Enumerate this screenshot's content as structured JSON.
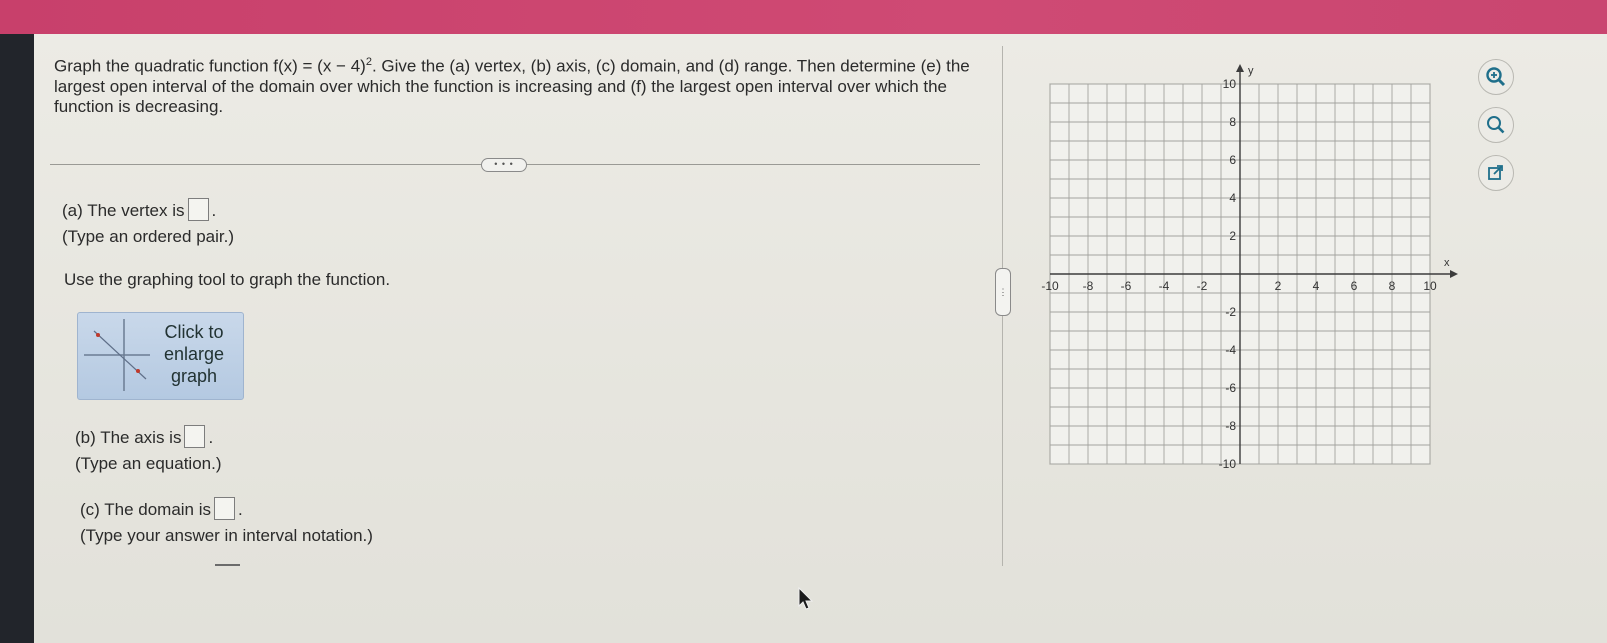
{
  "question": {
    "intro": "Graph the quadratic function f(x) = (x − 4)",
    "exponent": "2",
    "rest": ". Give the (a) vertex, (b) axis, (c) domain, and (d) range. Then determine (e) the largest open interval of the domain over which the function is increasing and (f) the largest open interval over which the function is decreasing."
  },
  "divider_handle": "• • •",
  "splitter_handle": "⋮",
  "part_a": {
    "label": "(a) The vertex is",
    "end": ".",
    "hint": "(Type an ordered pair.)",
    "value": ""
  },
  "graph_instruction": "Use the graphing tool to graph the function.",
  "enlarge_button": {
    "label": "Click to enlarge graph"
  },
  "part_b": {
    "label": "(b) The axis is",
    "end": ".",
    "hint": "(Type an equation.)",
    "value": ""
  },
  "part_c": {
    "label": "(c) The domain is",
    "end": ".",
    "hint": "(Type your answer in interval notation.)",
    "value": ""
  },
  "graph": {
    "x_axis_label": "x",
    "y_axis_label": "y",
    "x_ticks": [
      "-10",
      "-8",
      "-6",
      "-4",
      "-2",
      "2",
      "4",
      "6",
      "8",
      "10"
    ],
    "y_ticks": [
      "10",
      "8",
      "6",
      "4",
      "2",
      "-2",
      "-4",
      "-6",
      "-8",
      "-10"
    ],
    "x_range": [
      -10,
      10
    ],
    "y_range": [
      -10,
      10
    ],
    "grid": true
  },
  "tools": [
    {
      "name": "zoom-in-icon"
    },
    {
      "name": "zoom-out-icon"
    },
    {
      "name": "popout-icon"
    }
  ],
  "colors": {
    "header": "#c8406b",
    "accent_button": "#b4c9e1",
    "icon_teal": "#1f6f8b"
  }
}
